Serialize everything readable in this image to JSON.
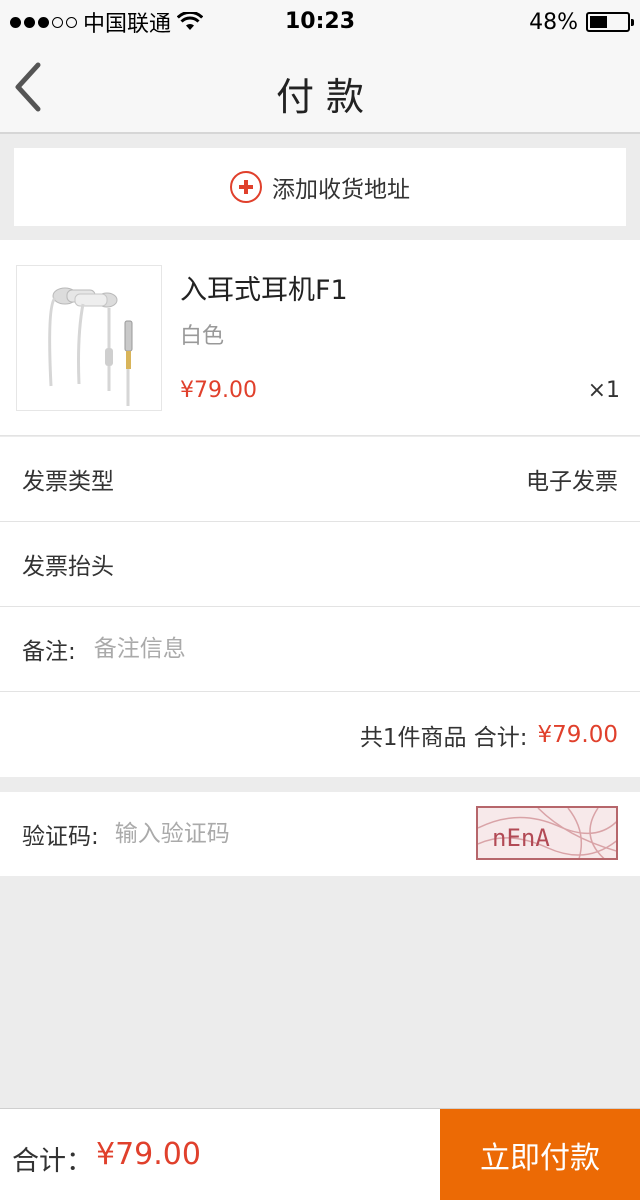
{
  "status_bar": {
    "carrier": "中国联通",
    "time": "10:23",
    "battery_text": "48%",
    "battery_level": 0.48,
    "signal_icon": "signal-dots-icon",
    "wifi_icon": "wifi-icon"
  },
  "nav": {
    "title": "付款",
    "back_icon": "chevron-left-icon"
  },
  "address": {
    "label": "添加收货地址",
    "icon": "plus-circle-icon",
    "accent": "#e0402c"
  },
  "product": {
    "name": "入耳式耳机F1",
    "color": "白色",
    "price": "¥79.00",
    "quantity": "×1",
    "image_icon": "earphone-product-image"
  },
  "invoice": {
    "type_label": "发票类型",
    "type_value": "电子发票",
    "header_label": "发票抬头"
  },
  "remark": {
    "label": "备注:",
    "placeholder": "备注信息"
  },
  "summary": {
    "prefix": "共1件商品 合计:",
    "amount": "¥79.00"
  },
  "captcha": {
    "label": "验证码:",
    "placeholder": "输入验证码",
    "image_text": "nEnA"
  },
  "bottom": {
    "total_label": "合计：",
    "total_value": "¥79.00",
    "pay_button": "立即付款",
    "pay_color": "#ec6a05"
  }
}
